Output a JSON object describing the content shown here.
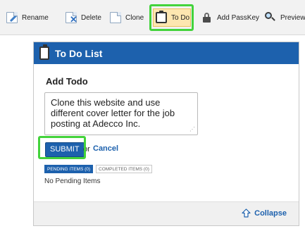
{
  "toolbar": {
    "rename_label": "Rename",
    "delete_label": "Delete",
    "clone_label": "Clone",
    "todo_label": "To Do",
    "passkey_label": "Add PassKey",
    "preview_label": "Preview"
  },
  "panel": {
    "title": "To Do List",
    "add_title": "Add Todo",
    "todo_text": "Clone this website and use different cover letter for the job posting at Adecco Inc.",
    "submit_label": "SUBMIT",
    "or_text": "or",
    "cancel_label": "Cancel",
    "tabs": [
      {
        "label": "PENDING ITEMS (0)",
        "active": true
      },
      {
        "label": "COMPLETED ITEMS (0)",
        "active": false
      }
    ],
    "empty_message": "No Pending Items",
    "collapse_label": "Collapse"
  },
  "colors": {
    "accent": "#1d61ad",
    "highlight": "#43d33b",
    "active_tab_bg": "#fde6b0"
  }
}
